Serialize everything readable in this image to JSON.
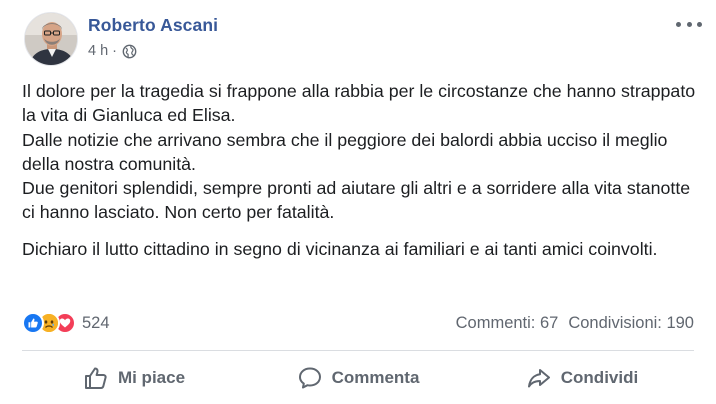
{
  "post": {
    "author": "Roberto Ascani",
    "time": "4 h",
    "separator": "·",
    "privacy_icon": "globe-icon",
    "more_icon": "more-options-icon",
    "paragraphs": [
      "Il dolore per la tragedia si frappone alla rabbia per le circostanze che hanno strappato la vita di Gianluca ed Elisa.",
      "Dalle notizie che arrivano sembra che il peggiore dei balordi abbia ucciso il meglio della nostra comunità.",
      "Due genitori splendidi, sempre pronti ad aiutare gli altri e a sorridere alla vita stanotte ci hanno lasciato. Non certo per fatalità.",
      "Dichiaro il lutto cittadino in segno di vicinanza ai familiari e ai tanti amici coinvolti."
    ]
  },
  "stats": {
    "reaction_icons": [
      "like-reaction-icon",
      "sad-reaction-icon",
      "love-reaction-icon"
    ],
    "reaction_count": "524",
    "comments": "Commenti: 67",
    "shares": "Condivisioni: 190"
  },
  "actions": {
    "like": "Mi piace",
    "comment": "Commenta",
    "share": "Condividi"
  },
  "colors": {
    "author": "#385898",
    "like": "#1877f2",
    "sad": "#f7b125",
    "love": "#f33e58",
    "muted": "#606770"
  }
}
